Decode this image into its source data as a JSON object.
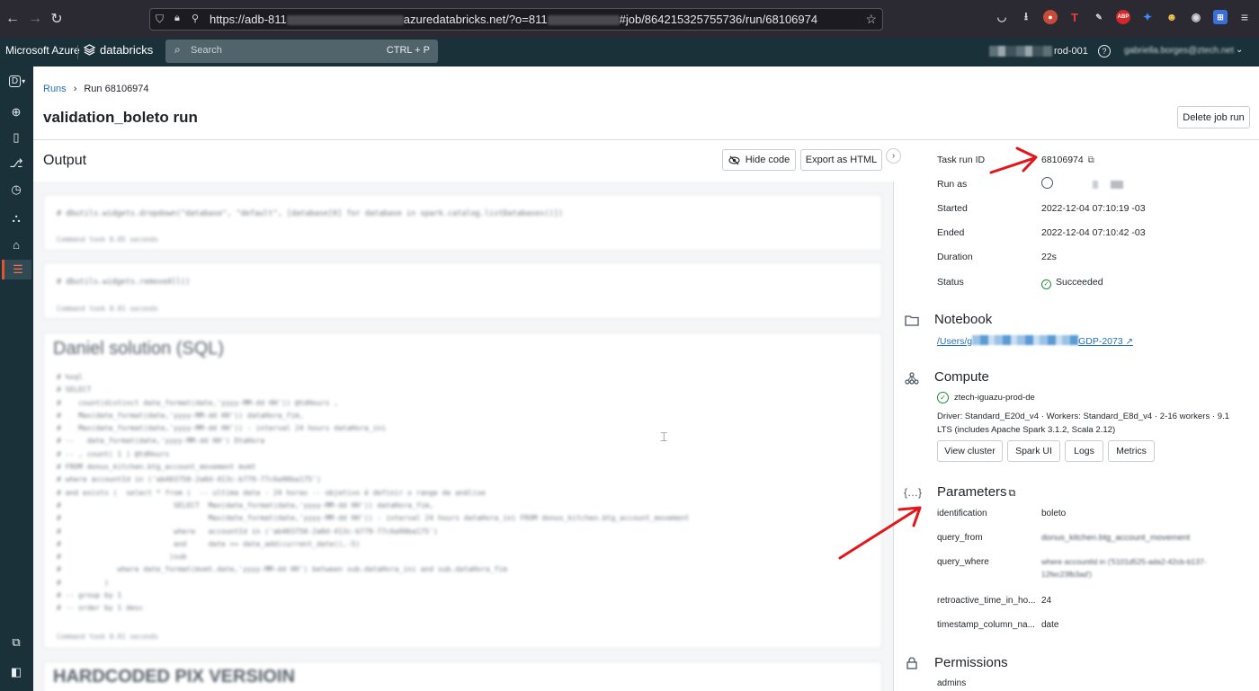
{
  "browser": {
    "url_prefix": "https://adb-811",
    "url_domain": "azuredatabricks.net/?o=811",
    "url_suffix": "#job/864215325755736/run/68106974"
  },
  "topbar": {
    "brand": "Microsoft Azure",
    "product": "databricks",
    "search_placeholder": "Search",
    "search_shortcut": "CTRL + P",
    "workspace": "rod-001",
    "user": "gabriella.borges@ztech.net"
  },
  "breadcrumb": {
    "parent": "Runs",
    "sep": "›",
    "current": "Run 68106974"
  },
  "page": {
    "title": "validation_boleto run",
    "delete_label": "Delete job run"
  },
  "output": {
    "title": "Output",
    "hide_code": "Hide code",
    "export": "Export as HTML",
    "cells": {
      "c1_code": "# dbutils.widgets.dropdown(\"database\", \"default\", [database[0] for database in spark.catalog.listDatabases()])",
      "c1_took": "Command took 0.05 seconds",
      "c2_code": "# dbutils.widgets.removeAll()",
      "c2_took": "Command took 0.01 seconds",
      "c3_heading": "Daniel solution (SQL)",
      "c3_code": "# %sql\n# SELECT\n#    count(distinct date_format(date,'yyyy-MM-dd HH')) @tdHours ,\n#    Max(date_format(date,'yyyy-MM-dd HH')) dataHora_fim,\n#    Max(date_format(date,'yyyy-MM-dd HH')) - interval 24 hours dataHora_ini\n# --   date_format(date,'yyyy-MM-dd HH') DtaHora\n# -- , count( 1 ) @tdHours\n# FROM donus_kitchen.btg_account_movement mvmt\n# where accountId in ('ab403750-2a0d-413c-b779-77c6a90ba175')\n# and exists (  select * from (  -- ultima data - 24 horas -- objetivo é definir o range de análise\n#                          SELECT  Max(date_format(date,'yyyy-MM-dd HH')) dataHora_fim,\n#                                  Max(date_format(date,'yyyy-MM-dd HH')) - interval 24 hours dataHora_ini FROM donus_kitchen.btg_account_movement\n#                          where   accountId in ('ab403750-2a0d-413c-b779-77c6a90ba175')\n#                          and     date >= date_add(current_date(),-5)\n#                         )sub\n#             where date_format(mvmt.date,'yyyy-MM-dd HH') between sub.dataHora_ini and sub.dataHora_fim\n#          )\n# -- group by 1\n# -- order by 1 desc",
      "c3_took": "Command took 0.01 seconds",
      "c4_heading": "HARDCODED PIX VERSIOIN"
    }
  },
  "details": {
    "task_run_id_label": "Task run ID",
    "task_run_id": "68106974",
    "run_as_label": "Run as",
    "started_label": "Started",
    "started": "2022-12-04 07:10:19 -03",
    "ended_label": "Ended",
    "ended": "2022-12-04 07:10:42 -03",
    "duration_label": "Duration",
    "duration": "22s",
    "status_label": "Status",
    "status": "Succeeded"
  },
  "notebook": {
    "title": "Notebook",
    "path_start": "/Users/g",
    "path_end": "GDP-2073"
  },
  "compute": {
    "title": "Compute",
    "cluster": "ztech-iguazu-prod-de",
    "driver_line1": "Driver: Standard_E20d_v4 · Workers: Standard_E8d_v4 · 2-16 workers · 9.1",
    "driver_line2": "LTS (includes Apache Spark 3.1.2, Scala 2.12)",
    "btn_view": "View cluster",
    "btn_spark": "Spark UI",
    "btn_logs": "Logs",
    "btn_metrics": "Metrics"
  },
  "parameters": {
    "title": "Parameters",
    "rows": [
      {
        "key": "identification",
        "value": "boleto"
      },
      {
        "key": "query_from",
        "value": "donus_kitchen.btg_account_movement"
      },
      {
        "key": "query_where",
        "value": "where accountId in ('5101d525-ada2-42cb-b137-12fec23fb3ad')"
      },
      {
        "key": "retroactive_time_in_ho...",
        "value": "24"
      },
      {
        "key": "timestamp_column_na...",
        "value": "date"
      }
    ]
  },
  "permissions": {
    "title": "Permissions",
    "first": "admins"
  },
  "colors": {
    "topbar": "#1b3139",
    "link": "#2272b4",
    "success": "#1b8a3a",
    "annotation_arrow": "#e3151a"
  }
}
